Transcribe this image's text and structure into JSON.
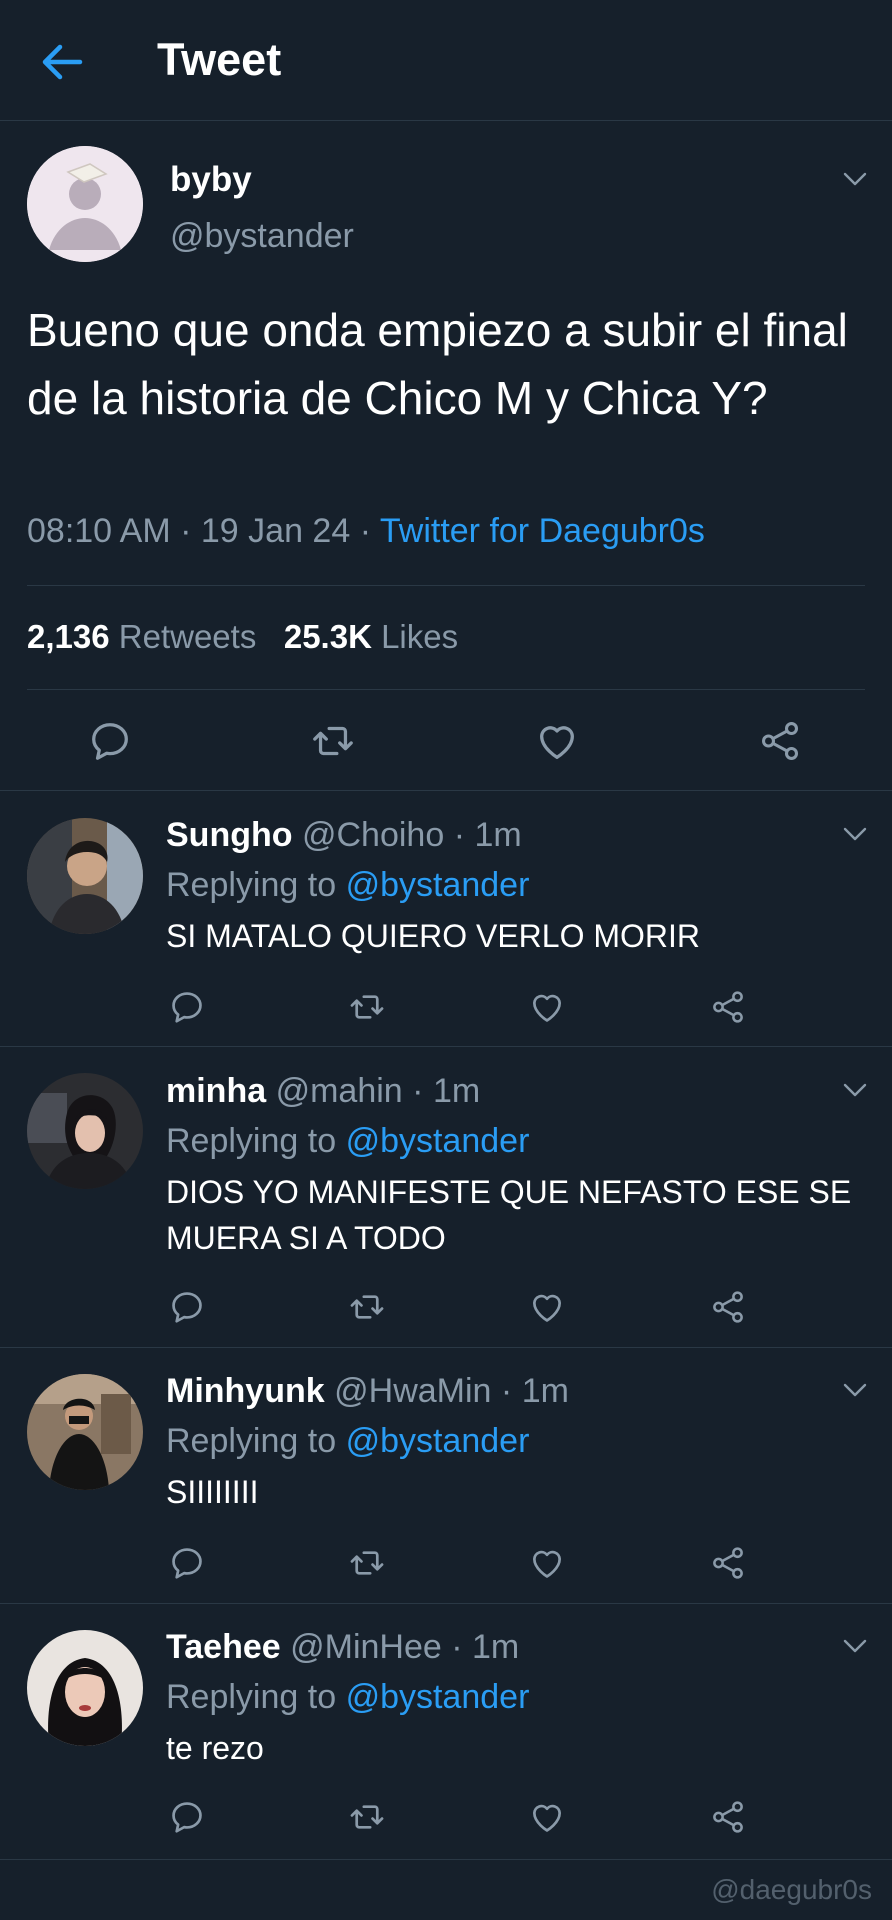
{
  "header": {
    "title": "Tweet"
  },
  "tweet": {
    "name": "byby",
    "handle": "@bystander",
    "text": "Bueno que onda empiezo a subir el final de la historia de Chico M y Chica Y?",
    "time": "08:10 AM",
    "date": "19 Jan 24",
    "source": "Twitter for Daegubr0s",
    "retweets_count": "2,136",
    "retweets_label": "Retweets",
    "likes_count": "25.3K",
    "likes_label": "Likes"
  },
  "replies": [
    {
      "name": "Sungho",
      "handle": "@Choiho",
      "time": "1m",
      "replying_label": "Replying to",
      "mention": "@bystander",
      "text": "SI MATALO QUIERO VERLO MORIR"
    },
    {
      "name": "minha",
      "handle": "@mahin",
      "time": "1m",
      "replying_label": "Replying to",
      "mention": "@bystander",
      "text": "DIOS YO MANIFESTE QUE NEFASTO ESE SE MUERA SI A TODO"
    },
    {
      "name": "Minhyunk",
      "handle": "@HwaMin",
      "time": "1m",
      "replying_label": "Replying to",
      "mention": "@bystander",
      "text": "SIIIIIIII"
    },
    {
      "name": "Taehee",
      "handle": "@MinHee",
      "time": "1m",
      "replying_label": "Replying to",
      "mention": "@bystander",
      "text": "te rezo"
    }
  ],
  "watermark": "@daegubr0s",
  "colors": {
    "background": "#16202b",
    "accent": "#2a9df4",
    "secondary_text": "#8a9aa9",
    "divider": "#2a3845"
  },
  "icons": [
    "back-arrow-icon",
    "chevron-down-icon",
    "reply-icon",
    "retweet-icon",
    "like-icon",
    "share-icon"
  ]
}
